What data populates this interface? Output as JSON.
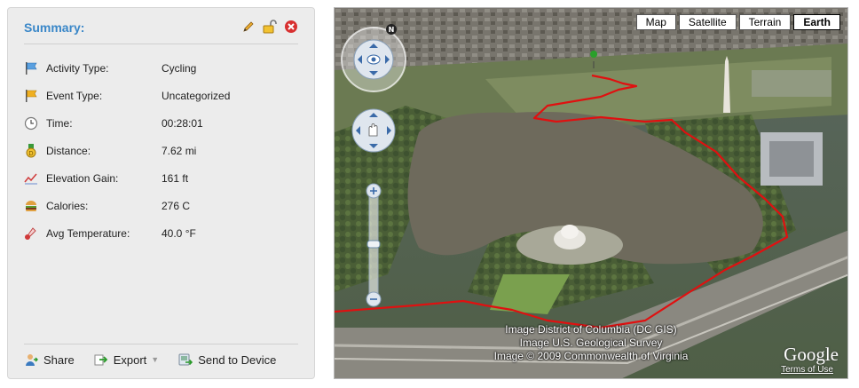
{
  "summary": {
    "title": "Summary:",
    "stats": [
      {
        "label": "Activity Type:",
        "value": "Cycling",
        "icon": "activity-flag-icon"
      },
      {
        "label": "Event Type:",
        "value": "Uncategorized",
        "icon": "event-flag-icon"
      },
      {
        "label": "Time:",
        "value": "00:28:01",
        "icon": "clock-icon"
      },
      {
        "label": "Distance:",
        "value": "7.62 mi",
        "icon": "distance-medal-icon"
      },
      {
        "label": "Elevation Gain:",
        "value": "161 ft",
        "icon": "elevation-chart-icon"
      },
      {
        "label": "Calories:",
        "value": "276 C",
        "icon": "burger-icon"
      },
      {
        "label": "Avg Temperature:",
        "value": "40.0 °F",
        "icon": "thermometer-icon"
      }
    ],
    "actions": {
      "share": "Share",
      "export": "Export",
      "send": "Send to Device"
    }
  },
  "map": {
    "types": [
      "Map",
      "Satellite",
      "Terrain",
      "Earth"
    ],
    "active_type": "Earth",
    "compass_letter": "N",
    "attribution": [
      "Image District of Columbia (DC GIS)",
      "Image U.S. Geological Survey",
      "Image © 2009 Commonwealth of Virginia"
    ],
    "logo": "Google",
    "terms": "Terms of Use",
    "route_color": "#e01010"
  },
  "colors": {
    "accent": "#3a87c8",
    "panel_bg": "#ececec"
  }
}
